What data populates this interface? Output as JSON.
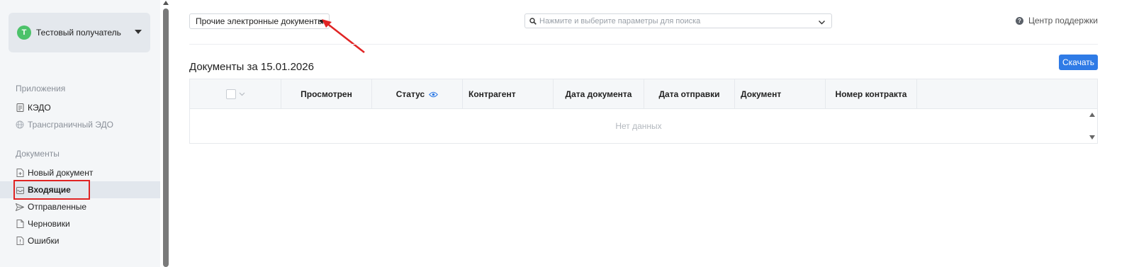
{
  "sidebar": {
    "user": {
      "initial": "T",
      "name": "Тестовый получатель"
    },
    "apps_title": "Приложения",
    "apps": [
      {
        "label": "КЭДО",
        "icon": "document-icon",
        "muted": false
      },
      {
        "label": "Трансграничный ЭДО",
        "icon": "globe-icon",
        "muted": true
      }
    ],
    "docs_title": "Документы",
    "docs": [
      {
        "label": "Новый документ",
        "icon": "new-document-icon"
      },
      {
        "label": "Входящие",
        "icon": "inbox-icon",
        "active": true
      },
      {
        "label": "Отправленные",
        "icon": "send-icon"
      },
      {
        "label": "Черновики",
        "icon": "draft-icon"
      },
      {
        "label": "Ошибки",
        "icon": "error-doc-icon"
      }
    ]
  },
  "header": {
    "doc_type_value": "Прочие электронные документы",
    "search_placeholder": "Нажмите и выберите параметры для поиска",
    "help_label": "Центр поддержки"
  },
  "main": {
    "title": "Документы за 15.01.2026",
    "download_label": "Скачать",
    "table": {
      "columns": [
        "Просмотрен",
        "Статус",
        "Контрагент",
        "Дата документа",
        "Дата отправки",
        "Документ",
        "Номер контракта"
      ],
      "empty_text": "Нет данных"
    }
  },
  "colors": {
    "accent": "#2f7be6",
    "avatar": "#4cc26a",
    "annotation": "#e02424"
  }
}
